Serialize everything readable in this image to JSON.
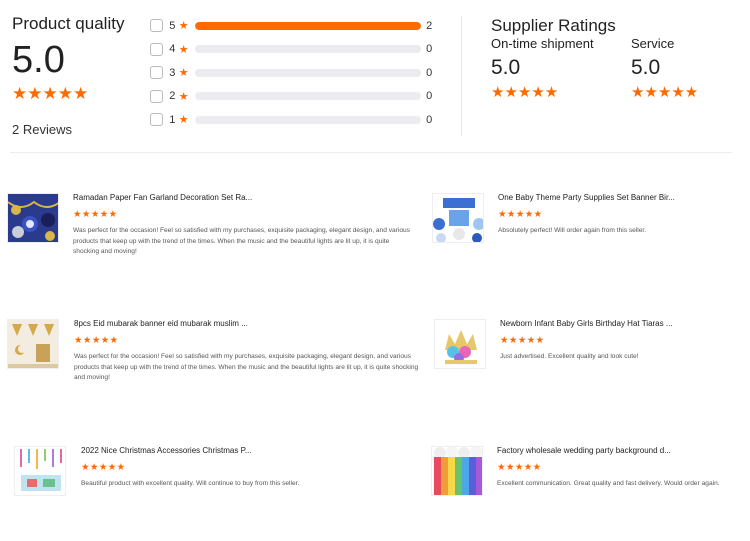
{
  "product_quality": {
    "title": "Product quality",
    "score": "5.0",
    "stars": "★★★★★",
    "reviews_label": "2 Reviews"
  },
  "histogram": [
    {
      "stars": "5",
      "count": "2",
      "fraction": 1.0
    },
    {
      "stars": "4",
      "count": "0",
      "fraction": 0
    },
    {
      "stars": "3",
      "count": "0",
      "fraction": 0
    },
    {
      "stars": "2",
      "count": "0",
      "fraction": 0
    },
    {
      "stars": "1",
      "count": "0",
      "fraction": 0
    }
  ],
  "supplier_ratings": {
    "title": "Supplier Ratings",
    "on_time": {
      "label": "On-time shipment",
      "value": "5.0",
      "stars": "★★★★★"
    },
    "service": {
      "label": "Service",
      "value": "5.0",
      "stars": "★★★★★"
    }
  },
  "reviews": [
    {
      "title": "Ramadan Paper Fan Garland Decoration Set Ra...",
      "stars": "★★★★★",
      "text": "Was perfect for the occasion! Feel so satisfied with my purchases, exquisite packaging, elegant design, and various products that keep up with the trend of the times. When the music and the beautiful lights are lit up, it is quite shocking and moving!",
      "thumb_icon": "ramadan-garland-thumbnail"
    },
    {
      "title": "One Baby Theme Party Supplies Set Banner Bir...",
      "stars": "★★★★★",
      "text": "Absolutely perfect! Will order again from this seller.",
      "thumb_icon": "baby-party-thumbnail"
    },
    {
      "title": "8pcs Eid mubarak banner eid mubarak muslim ...",
      "stars": "★★★★★",
      "text": "Was perfect for the occasion! Feel so satisfied with my purchases, exquisite packaging, elegant design, and various products that keep up with the trend of the times. When the music and the beautiful lights are lit up, it is quite shocking and moving!",
      "thumb_icon": "eid-banner-thumbnail"
    },
    {
      "title": "Newborn Infant Baby Girls Birthday Hat Tiaras ...",
      "stars": "★★★★★",
      "text": "Just advertised. Excellent quality and look cute!",
      "thumb_icon": "tiara-thumbnail"
    },
    {
      "title": "2022 Nice Christmas Accessories Christmas P...",
      "stars": "★★★★★",
      "text": "Beautiful product with excellent quality. Will continue to buy from this seller.",
      "thumb_icon": "christmas-thumbnail"
    },
    {
      "title": "Factory wholesale wedding party background d...",
      "stars": "★★★★★",
      "text": "Excellent communication. Great quality and fast delivery. Would order again.",
      "thumb_icon": "rainbow-backdrop-thumbnail"
    }
  ],
  "colors": {
    "accent": "#ff6a00",
    "track": "#ececf0"
  }
}
